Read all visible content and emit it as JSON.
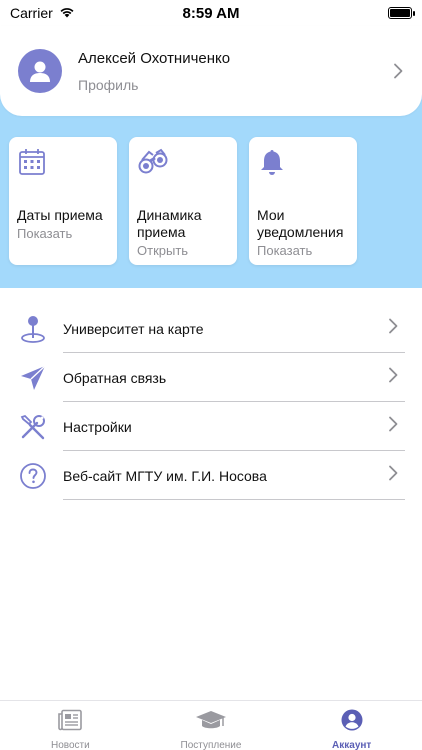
{
  "status": {
    "carrier": "Carrier",
    "time": "8:59 AM"
  },
  "profile": {
    "name": "Алексей Охотниченко",
    "subtitle": "Профиль"
  },
  "cards": [
    {
      "title": "Даты приема",
      "action": "Показать",
      "icon": "calendar-icon"
    },
    {
      "title": "Динамика приема",
      "action": "Открыть",
      "icon": "binoculars-icon"
    },
    {
      "title": "Мои уведомления",
      "action": "Показать",
      "icon": "bell-icon"
    }
  ],
  "menu": [
    {
      "label": "Университет на карте",
      "icon": "map-pin-icon"
    },
    {
      "label": "Обратная связь",
      "icon": "paper-plane-icon"
    },
    {
      "label": "Настройки",
      "icon": "tools-icon"
    },
    {
      "label": "Веб-сайт МГТУ им. Г.И. Носова",
      "icon": "question-icon"
    }
  ],
  "tabs": [
    {
      "label": "Новости",
      "icon": "newspaper-icon",
      "active": false
    },
    {
      "label": "Поступление",
      "icon": "graduation-cap-icon",
      "active": false
    },
    {
      "label": "Аккаунт",
      "icon": "account-icon",
      "active": true
    }
  ],
  "colors": {
    "accent": "#7b7fcf",
    "band": "#a3d9fb",
    "tab_active": "#5b5fb5",
    "muted": "#8e8e93"
  }
}
